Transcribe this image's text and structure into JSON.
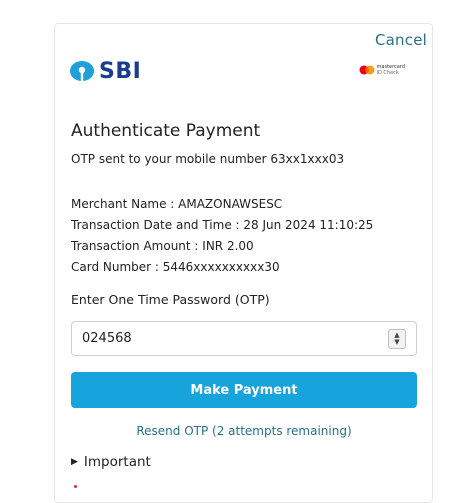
{
  "header": {
    "cancel_label": "Cancel",
    "bank_logo_text": "SBI",
    "scheme_logo_line1": "mastercard",
    "scheme_logo_line2": "ID Check"
  },
  "main": {
    "title": "Authenticate Payment",
    "otp_sent_text": "OTP sent to your mobile number 63xx1xxx03",
    "details": [
      "Merchant Name : AMAZONAWSESC",
      "Transaction Date and Time : 28 Jun 2024 11:10:25",
      "Transaction Amount : INR 2.00",
      "Card Number : 5446xxxxxxxxxx30"
    ],
    "otp_label": "Enter One Time Password (OTP)",
    "otp_value": "024568",
    "make_payment_label": "Make Payment",
    "resend_label": "Resend OTP (2 attempts remaining)",
    "important_label": "Important"
  },
  "colors": {
    "accent": "#17a4dc",
    "link": "#2a6f86",
    "sbi_blue": "#1a3e8e"
  },
  "icons": {
    "stepper_up": "▲",
    "stepper_down": "▼",
    "disclosure": "▶"
  }
}
